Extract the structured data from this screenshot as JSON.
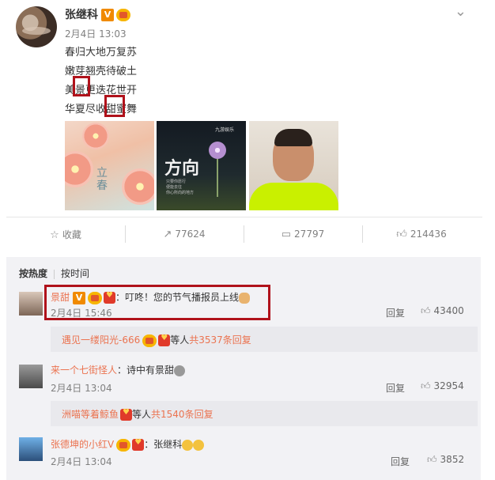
{
  "post": {
    "author": "张继科",
    "v_badge": "V",
    "time": "2月4日 13:03",
    "lines": [
      "春归大地万复苏",
      "嫩芽翘壳待破土",
      "美景更迭花世开",
      "华夏尽收甜蜜舞"
    ],
    "images": [
      {
        "text": "立\n春"
      },
      {
        "title": "方向",
        "small": "只要你愿行\n便能去往\n你心所向的地方",
        "logo": "九游娱乐"
      },
      {}
    ]
  },
  "actions": {
    "favorite": "收藏",
    "forward_count": "77624",
    "comment_count": "27797",
    "like_count": "214436"
  },
  "comments_tabs": {
    "hot": "按热度",
    "time": "按时间"
  },
  "comments": [
    {
      "name": "景甜",
      "v_badge": "V",
      "text": "：叮咚！您的节气播报员上线",
      "time": "2月4日 15:46",
      "reply": "回复",
      "likes": "43400",
      "sub": {
        "user": "遇见一缕阳光-666",
        "mid": "等人",
        "count": "共3537条回复"
      }
    },
    {
      "name": "来一个七街怪人",
      "text": "：诗中有景甜",
      "time": "2月4日 13:04",
      "reply": "回复",
      "likes": "32954",
      "sub": {
        "user": "洲喵等着鲸鱼",
        "mid": "等人",
        "count": "共1540条回复"
      }
    },
    {
      "name": "张德坤的小红V",
      "text": "：张继科",
      "time": "2月4日 13:04",
      "reply": "回复",
      "likes": "3852"
    }
  ]
}
